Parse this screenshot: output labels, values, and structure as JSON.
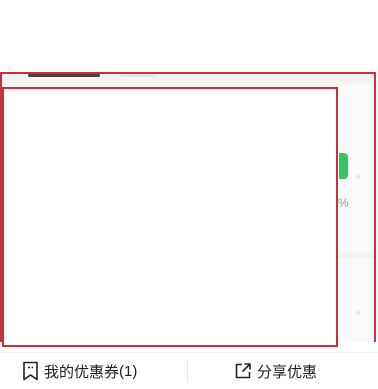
{
  "background": {
    "percent_label": "%"
  },
  "bottom_bar": {
    "my_coupons_label": "我的优惠券",
    "my_coupons_count": "(1)",
    "share_label": "分享优惠"
  },
  "colors": {
    "frame_red": "#c8323a",
    "accent_green": "#36c463"
  },
  "icons": {
    "coupon": "bookmark-coupon-icon",
    "share": "external-share-icon"
  }
}
